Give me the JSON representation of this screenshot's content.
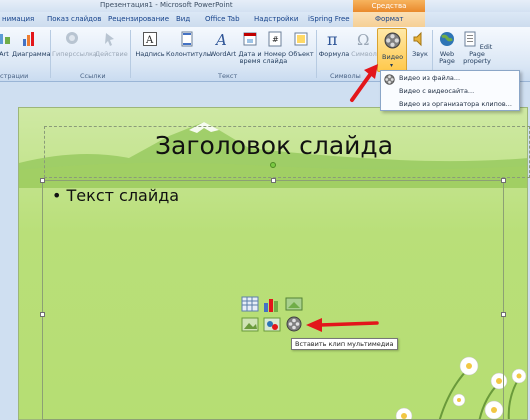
{
  "window": {
    "title": "Презентация1 - Microsoft PowerPoint"
  },
  "context_tab_header": "Средства рисования",
  "tabs": [
    {
      "label": "нимация"
    },
    {
      "label": "Показ слайдов"
    },
    {
      "label": "Рецензирование"
    },
    {
      "label": "Вид"
    },
    {
      "label": "Office Tab"
    },
    {
      "label": "Надстройки"
    },
    {
      "label": "iSpring Free"
    },
    {
      "label": "Формат"
    }
  ],
  "ribbon": {
    "buttons": {
      "art": "Art",
      "chart": "Диаграмма",
      "hyperlink": "Гиперссылка",
      "action": "Действие",
      "textbox": "Надпись",
      "header_footer": "Колонтитулы",
      "wordart": "WordArt",
      "datetime": "Дата и время",
      "slide_number": "Номер слайда",
      "object": "Объект",
      "formula": "Формула",
      "symbol": "Символ",
      "video": "Видео",
      "audio": "Звук",
      "web_page": "Web Page",
      "edit_page_property": "Edit Page property"
    },
    "groups": {
      "illustrations": "страции",
      "links": "Ссылки",
      "text": "Текст",
      "symbols": "Символы"
    }
  },
  "video_menu": {
    "items": [
      "Видео из файла...",
      "Видео с видеосайта...",
      "Видео из организатора клипов..."
    ]
  },
  "slide": {
    "title": "Заголовок слайда",
    "bullet": "Текст слайда"
  },
  "tooltip": "Вставить клип мультимедиа",
  "colors": {
    "accent_red": "#e3161b",
    "context_tab": "#e9892c",
    "slide_green": "#b9df79"
  }
}
